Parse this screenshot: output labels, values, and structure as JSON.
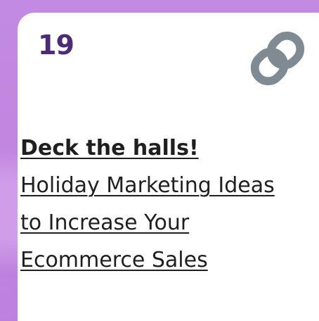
{
  "card": {
    "number": "19",
    "icon": "link-icon",
    "headline": "Deck the halls!",
    "subtitle_lines": [
      "Holiday Marketing Ideas",
      "to Increase Your ",
      "Ecommerce Sales"
    ]
  },
  "colors": {
    "background": "#c58be0",
    "card_background": "#ffffff",
    "number_color": "#4d2b77",
    "text_color": "#1f1f1f",
    "icon_color": "#7f8a93"
  }
}
